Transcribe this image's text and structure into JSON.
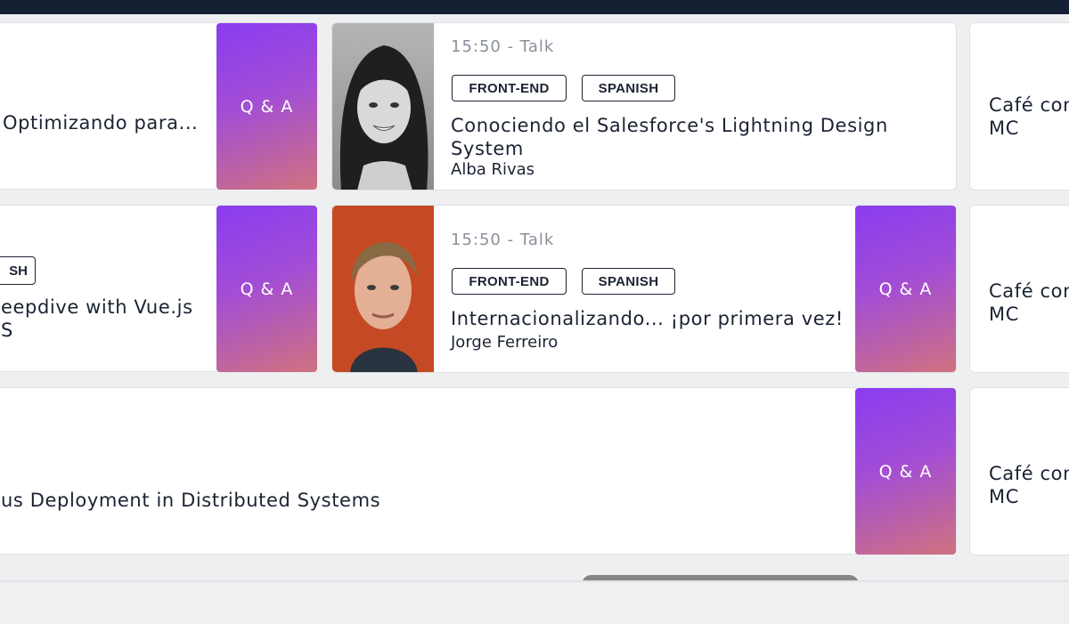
{
  "row1": {
    "left_title": "Optimizando para...",
    "left_qa": "Q & A",
    "talk": {
      "time": "15:50 - Talk",
      "tags": [
        "FRONT-END",
        "SPANISH"
      ],
      "title_line1": "Conociendo el Salesforce's Lightning Design",
      "title_line2": "System",
      "speaker": "Alba Rivas"
    },
    "right_title_line1": "Café con",
    "right_title_line2": "MC"
  },
  "row2": {
    "left_tag": "SH",
    "left_title_line1": "eepdive with Vue.js",
    "left_title_line2": "S",
    "left_qa": "Q & A",
    "talk": {
      "time": "15:50 - Talk",
      "tags": [
        "FRONT-END",
        "SPANISH"
      ],
      "title": "Internacionalizando... ¡por primera vez!",
      "speaker": "Jorge Ferreiro"
    },
    "qa": "Q & A",
    "right_title_line1": "Café con",
    "right_title_line2": "MC"
  },
  "row3": {
    "title": "us Deployment in Distributed Systems",
    "qa": "Q & A",
    "right_title_line1": "Café con",
    "right_title_line2": "MC"
  },
  "colors": {
    "header": "#141f33",
    "qa_gradient_start": "#8a3cf0",
    "qa_gradient_end": "#d0727f",
    "text": "#1b2333",
    "muted": "#8a909a"
  }
}
